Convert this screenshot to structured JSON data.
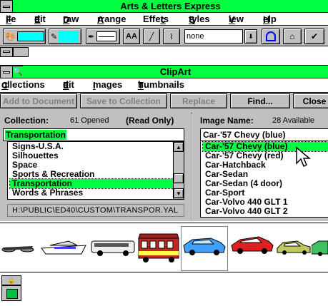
{
  "app": {
    "title": "Arts & Letters Express",
    "menu": [
      "File",
      "Edit",
      "Draw",
      "Arrange",
      "Effects",
      "Styles",
      "View",
      "Help"
    ],
    "toolbar": {
      "fill_color": "#00ffff",
      "line_color": "#00ffff",
      "aa_label": "AA",
      "none_value": "none"
    }
  },
  "clipart": {
    "title": "ClipArt",
    "menu": [
      "Collections",
      "Edit",
      "Images",
      "Thumbnails"
    ],
    "buttons": {
      "add": "Add to Document",
      "save": "Save to Collection",
      "replace": "Replace",
      "find": "Find...",
      "close": "Close"
    },
    "collection": {
      "label": "Collection:",
      "count": "61 Opened",
      "readonly": "(Read Only)",
      "current": "Transportation",
      "items": [
        "Signs-U.S.A.",
        "Silhouettes",
        "Space",
        "Sports & Recreation",
        "Transportation",
        "Words & Phrases"
      ],
      "selected_index": 4,
      "path": "H:\\PUBLIC\\ED40\\CUSTOM\\TRANSPOR.YAL"
    },
    "image": {
      "label": "Image Name:",
      "count": "28 Available",
      "current": "Car-'57 Chevy (blue)",
      "items": [
        "Car-'57 Chevy (blue)",
        "Car-'57 Chevy (red)",
        "Car-Hatchback",
        "Car-Sedan",
        "Car-Sedan (4 door)",
        "Car-Sport",
        "Car-Volvo 440 GLT 1",
        "Car-Volvo 440 GLT 2"
      ],
      "selected_index": 0
    },
    "thumbnails": [
      "motorcycle",
      "yacht",
      "bus",
      "trolley",
      "chevy-blue",
      "chevy-red",
      "hatchback",
      "sedan"
    ]
  },
  "colors": {
    "accent": "#00ff40",
    "cyan": "#00ffff",
    "chrome": "#c0c0c0"
  }
}
